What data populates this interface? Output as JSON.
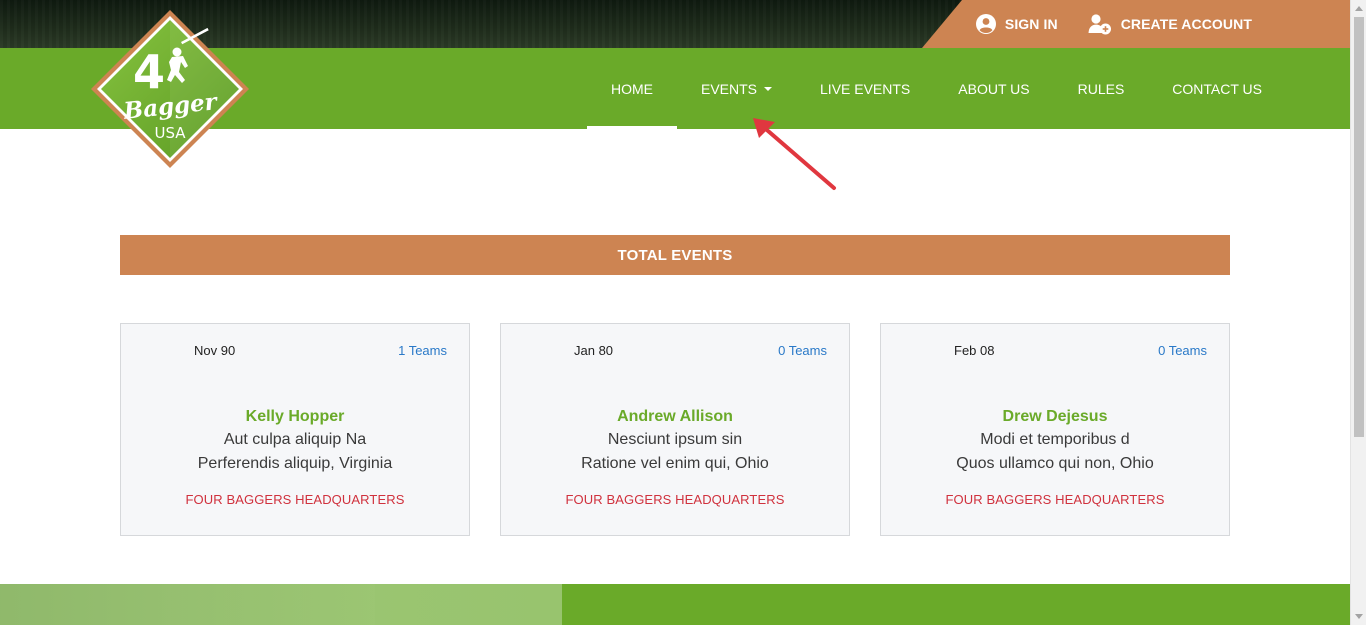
{
  "header": {
    "sign_in": "SIGN IN",
    "create_account": "CREATE ACCOUNT",
    "logo": {
      "number": "4",
      "word": "Bagger",
      "country": "USA"
    }
  },
  "nav": {
    "items": [
      {
        "label": "HOME",
        "active": true
      },
      {
        "label": "EVENTS",
        "dropdown": true
      },
      {
        "label": "LIVE EVENTS"
      },
      {
        "label": "ABOUT US"
      },
      {
        "label": "RULES"
      },
      {
        "label": "CONTACT US"
      }
    ]
  },
  "section": {
    "title": "TOTAL EVENTS"
  },
  "events": [
    {
      "date": "Nov 90",
      "teams": "1 Teams",
      "name": "Kelly Hopper",
      "line1": "Aut culpa aliquip Na",
      "line2": "Perferendis aliquip, Virginia",
      "venue": "FOUR BAGGERS HEADQUARTERS"
    },
    {
      "date": "Jan 80",
      "teams": "0 Teams",
      "name": "Andrew Allison",
      "line1": "Nesciunt ipsum sin",
      "line2": "Ratione vel enim qui, Ohio",
      "venue": "FOUR BAGGERS HEADQUARTERS"
    },
    {
      "date": "Feb 08",
      "teams": "0 Teams",
      "name": "Drew Dejesus",
      "line1": "Modi et temporibus d",
      "line2": "Quos ullamco qui non, Ohio",
      "venue": "FOUR BAGGERS HEADQUARTERS"
    }
  ],
  "colors": {
    "brand_green": "#6aaa29",
    "brand_orange": "#cd8452",
    "link_blue": "#2a79c8",
    "venue_red": "#d0313d",
    "annotation_red": "#e0373f"
  },
  "icons": [
    "user-circle-icon",
    "add-user-icon",
    "caret-down-icon",
    "annotation-arrow-icon"
  ]
}
